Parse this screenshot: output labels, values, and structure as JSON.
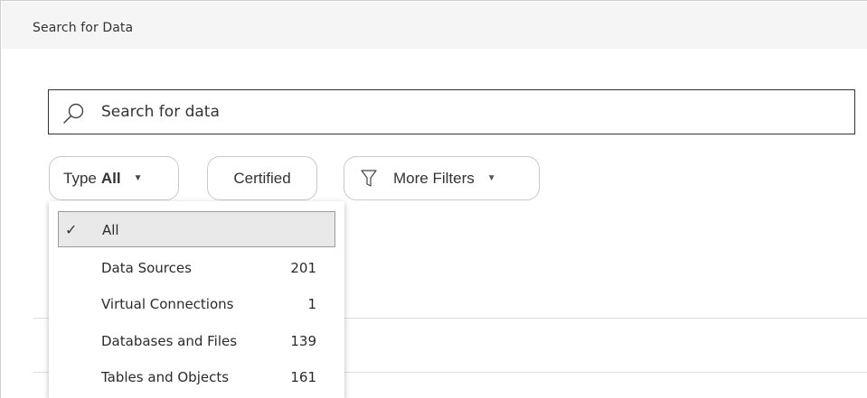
{
  "panel": {
    "title": "Search for Data"
  },
  "search": {
    "placeholder": "Search for data",
    "icon": "search-icon"
  },
  "filters": {
    "type": {
      "prefix": "Type",
      "value": "All"
    },
    "certified": {
      "label": "Certified"
    },
    "more_filters": {
      "label": "More Filters",
      "icon": "funnel-icon"
    }
  },
  "type_menu": {
    "items": [
      {
        "label": "All",
        "count": "",
        "selected": true
      },
      {
        "label": "Data Sources",
        "count": "201"
      },
      {
        "label": "Virtual Connections",
        "count": "1"
      },
      {
        "label": "Databases and Files",
        "count": "139"
      },
      {
        "label": "Tables and Objects",
        "count": "161"
      }
    ]
  },
  "colors": {
    "title_bar": "#f5f5f5",
    "border_dark": "#333333",
    "selected_bg": "#e9e9e9"
  }
}
